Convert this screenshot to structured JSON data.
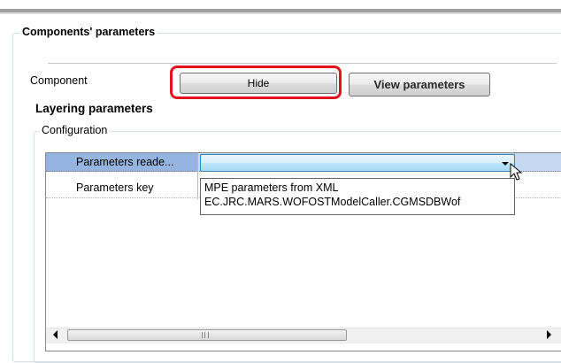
{
  "groups": {
    "main_title": "Components' parameters",
    "config_title": "Configuration"
  },
  "component": {
    "label": "Component",
    "hide_button": "Hide",
    "view_button": "View parameters"
  },
  "layering": {
    "title": "Layering parameters"
  },
  "property_grid": {
    "rows": [
      {
        "name": "Parameters reade...",
        "value": ""
      },
      {
        "name": "Parameters key",
        "value": ""
      }
    ],
    "dropdown_options": [
      "MPE parameters from XML",
      "EC.JRC.MARS.WOFOSTModelCaller.CGMSDBWof"
    ]
  },
  "colors": {
    "highlight": "#e8121e",
    "selected_row": "#c5d9f5"
  }
}
